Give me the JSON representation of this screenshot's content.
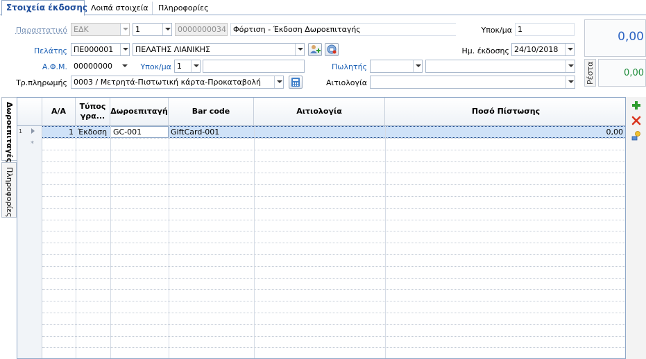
{
  "tabs": [
    {
      "label": "Στοιχεία έκδοσης",
      "active": true
    },
    {
      "label": "Λοιπά στοιχεία",
      "active": false
    },
    {
      "label": "Πληροφορίες",
      "active": false
    }
  ],
  "form": {
    "document_label": "Παραστατικό",
    "document_type": "ΕΔΚ",
    "series": "1",
    "number": "0000000034",
    "document_description": "Φόρτιση - Έκδοση Δωροεπιταγής",
    "branch_top_label": "Υποκ/μα",
    "branch_top_value": "1",
    "customer_label": "Πελάτης",
    "customer_code": "ΠΕ000001",
    "customer_name": "ΠΕΛΑΤΗΣ ΛΙΑΝΙΚΗΣ",
    "issue_date_label": "Ημ. έκδοσης",
    "issue_date": "24/10/2018",
    "tax_id_label": "Α.Φ.Μ.",
    "tax_id": "00000000",
    "branch_label": "Υποκ/μα",
    "branch_value": "1",
    "branch_name": "",
    "salesman_label": "Πωλητής",
    "salesman_code": "",
    "salesman_name": "",
    "payment_label": "Τρ.πληρωμής",
    "payment_value": "0003 / Μετρητά-Πιστωτική κάρτα-Προκαταβολή",
    "reason_label": "Αιτιολογία",
    "reason_value": ""
  },
  "totals": {
    "total_value": "0,00",
    "change_label": "Ρέστα",
    "change_value": "0,00"
  },
  "side_tabs": {
    "vouchers": "Δωροεπιταγές",
    "info": "Πληροφορίες"
  },
  "grid": {
    "columns": [
      "Α/Α",
      "Τύπος γρα...",
      "Δωροεπιταγή",
      "Bar code",
      "Αιτιολογία",
      "Ποσό Πίστωσης"
    ],
    "rows": [
      {
        "row_num": "1",
        "aa": "1",
        "type": "Έκδοση",
        "voucher": "GC-001",
        "barcode": "GiftCard-001",
        "reason": "",
        "amount": "0,00"
      }
    ],
    "new_row_marker": "*"
  },
  "toolbar_icons": [
    "add-icon",
    "delete-icon",
    "edit-icon"
  ],
  "colors": {
    "accent": "#1f4e9c",
    "label_blue": "#1a5fb4",
    "selection": "#cfe2f8",
    "add_green": "#2e9c2e",
    "delete_red": "#d9341e"
  }
}
